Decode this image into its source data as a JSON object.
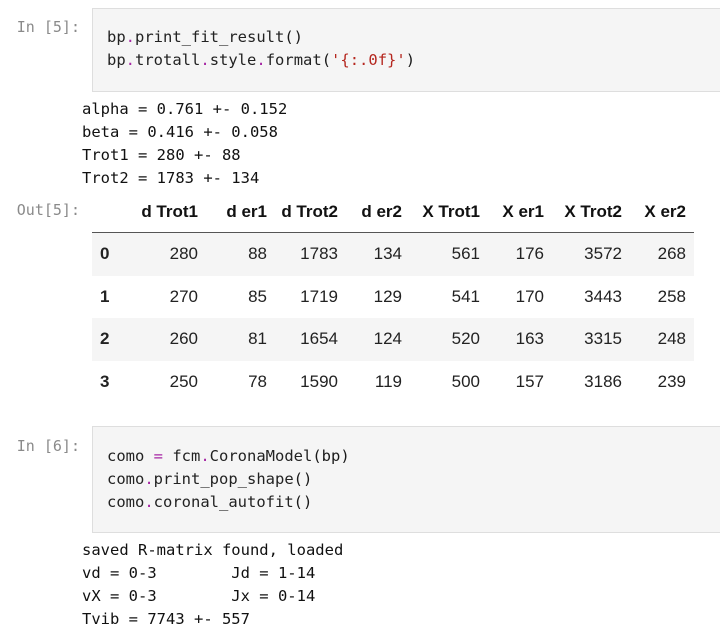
{
  "cell5": {
    "in_prompt": "In [5]:",
    "out_prompt": "Out[5]:",
    "code": {
      "line1": {
        "obj": "bp",
        "dot": ".",
        "method": "print_fit_result",
        "parens": "()"
      },
      "line2": {
        "obj": "bp",
        "dot1": ".",
        "attr": "trotall",
        "dot2": ".",
        "attr2": "style",
        "dot3": ".",
        "method": "format",
        "open": "(",
        "str": "'{:.0f}'",
        "close": ")"
      }
    },
    "stdout": [
      "alpha = 0.761 +- 0.152",
      "beta = 0.416 +- 0.058",
      "Trot1 = 280 +- 88",
      "Trot2 = 1783 +- 134"
    ],
    "table": {
      "columns": [
        "d Trot1",
        "d er1",
        "d Trot2",
        "d er2",
        "X Trot1",
        "X er1",
        "X Trot2",
        "X er2"
      ],
      "rows": [
        {
          "index": "0",
          "values": [
            "280",
            "88",
            "1783",
            "134",
            "561",
            "176",
            "3572",
            "268"
          ]
        },
        {
          "index": "1",
          "values": [
            "270",
            "85",
            "1719",
            "129",
            "541",
            "170",
            "3443",
            "258"
          ]
        },
        {
          "index": "2",
          "values": [
            "260",
            "81",
            "1654",
            "124",
            "520",
            "163",
            "3315",
            "248"
          ]
        },
        {
          "index": "3",
          "values": [
            "250",
            "78",
            "1590",
            "119",
            "500",
            "157",
            "3186",
            "239"
          ]
        }
      ]
    }
  },
  "cell6": {
    "in_prompt": "In [6]:",
    "code": {
      "line1": {
        "lhs": "como",
        "eq": " = ",
        "obj": "fcm",
        "dot": ".",
        "cls": "CoronaModel",
        "args": "(bp)"
      },
      "line2": {
        "obj": "como",
        "dot": ".",
        "method": "print_pop_shape",
        "parens": "()"
      },
      "line3": {
        "obj": "como",
        "dot": ".",
        "method": "coronal_autofit",
        "parens": "()"
      }
    },
    "stdout": [
      "saved R-matrix found, loaded",
      "vd = 0-3        Jd = 1-14",
      "vX = 0-3        Jx = 0-14",
      "Tvib = 7743 +- 557"
    ]
  },
  "colors": {
    "prompt": "#8a8a8a",
    "input_bg": "#f5f5f5",
    "input_border": "#dedede",
    "operator": "#a626a4",
    "string": "#b5271f",
    "row_stripe": "#f5f5f5"
  }
}
